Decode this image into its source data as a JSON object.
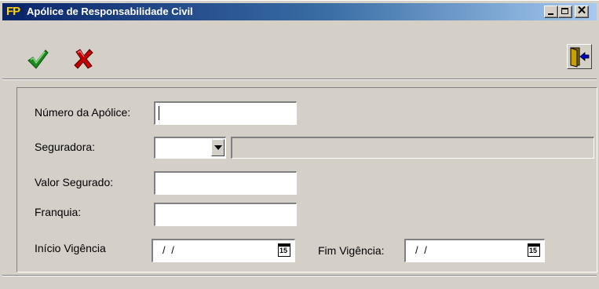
{
  "window": {
    "title": "Apólice de Responsabilidade Civil",
    "app_icon_text": "FP",
    "controls": {
      "minimize": "minimize-icon",
      "maximize": "maximize-icon",
      "close": "close-icon"
    }
  },
  "toolbar": {
    "confirm": {
      "icon": "checkmark-icon",
      "color": "#1d8a1d"
    },
    "cancel": {
      "icon": "x-icon",
      "color": "#c00000"
    },
    "exit": {
      "icon": "exit-door-icon"
    }
  },
  "form": {
    "numero_apolice": {
      "label": "Número da Apólice:",
      "value": ""
    },
    "seguradora": {
      "label": "Seguradora:",
      "code": "",
      "name": ""
    },
    "valor_segurado": {
      "label": "Valor Segurado:",
      "value": ""
    },
    "franquia": {
      "label": "Franquia:",
      "value": ""
    },
    "inicio_vigencia": {
      "label": "Início Vigência",
      "value": "/ /",
      "calendar_day": "15"
    },
    "fim_vigencia": {
      "label": "Fim Vigência:",
      "value": "/ /",
      "calendar_day": "15"
    }
  }
}
